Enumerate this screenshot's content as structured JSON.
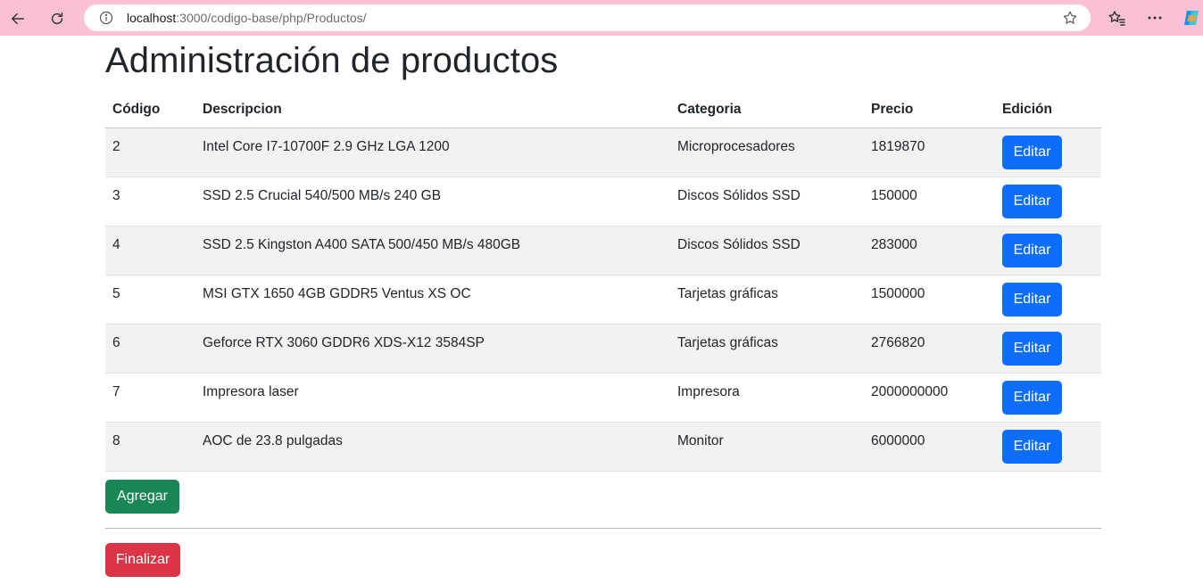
{
  "browser": {
    "url_host": "localhost",
    "url_rest": ":3000/codigo-base/php/Productos/",
    "icons": [
      "back-arrow-icon",
      "refresh-icon",
      "info-icon",
      "star-icon",
      "favorites-icon",
      "more-icon",
      "copilot-icon"
    ],
    "frame_color": "#f9c0d6"
  },
  "page": {
    "title": "Administración de productos"
  },
  "table": {
    "headers": {
      "code": "Código",
      "description": "Descripcion",
      "category": "Categoria",
      "price": "Precio",
      "edit": "Edición"
    },
    "rows": [
      {
        "code": "2",
        "description": "Intel Core I7-10700F 2.9 GHz LGA 1200",
        "category": "Microprocesadores",
        "price": "1819870",
        "edit_label": "Editar"
      },
      {
        "code": "3",
        "description": "SSD 2.5 Crucial 540/500 MB/s 240 GB",
        "category": "Discos Sólidos SSD",
        "price": "150000",
        "edit_label": "Editar"
      },
      {
        "code": "4",
        "description": "SSD 2.5 Kingston A400 SATA 500/450 MB/s 480GB",
        "category": "Discos Sólidos SSD",
        "price": "283000",
        "edit_label": "Editar"
      },
      {
        "code": "5",
        "description": "MSI GTX 1650 4GB GDDR5 Ventus XS OC",
        "category": "Tarjetas gráficas",
        "price": "1500000",
        "edit_label": "Editar"
      },
      {
        "code": "6",
        "description": "Geforce RTX 3060 GDDR6 XDS-X12 3584SP",
        "category": "Tarjetas gráficas",
        "price": "2766820",
        "edit_label": "Editar"
      },
      {
        "code": "7",
        "description": "Impresora laser",
        "category": "Impresora",
        "price": "2000000000",
        "edit_label": "Editar"
      },
      {
        "code": "8",
        "description": "AOC de 23.8 pulgadas",
        "category": "Monitor",
        "price": "6000000",
        "edit_label": "Editar"
      }
    ]
  },
  "actions": {
    "add_label": "Agregar",
    "finish_label": "Finalizar"
  },
  "colors": {
    "edit_button": "#0d6efd",
    "add_button": "#198754",
    "finish_button": "#dc3545"
  }
}
